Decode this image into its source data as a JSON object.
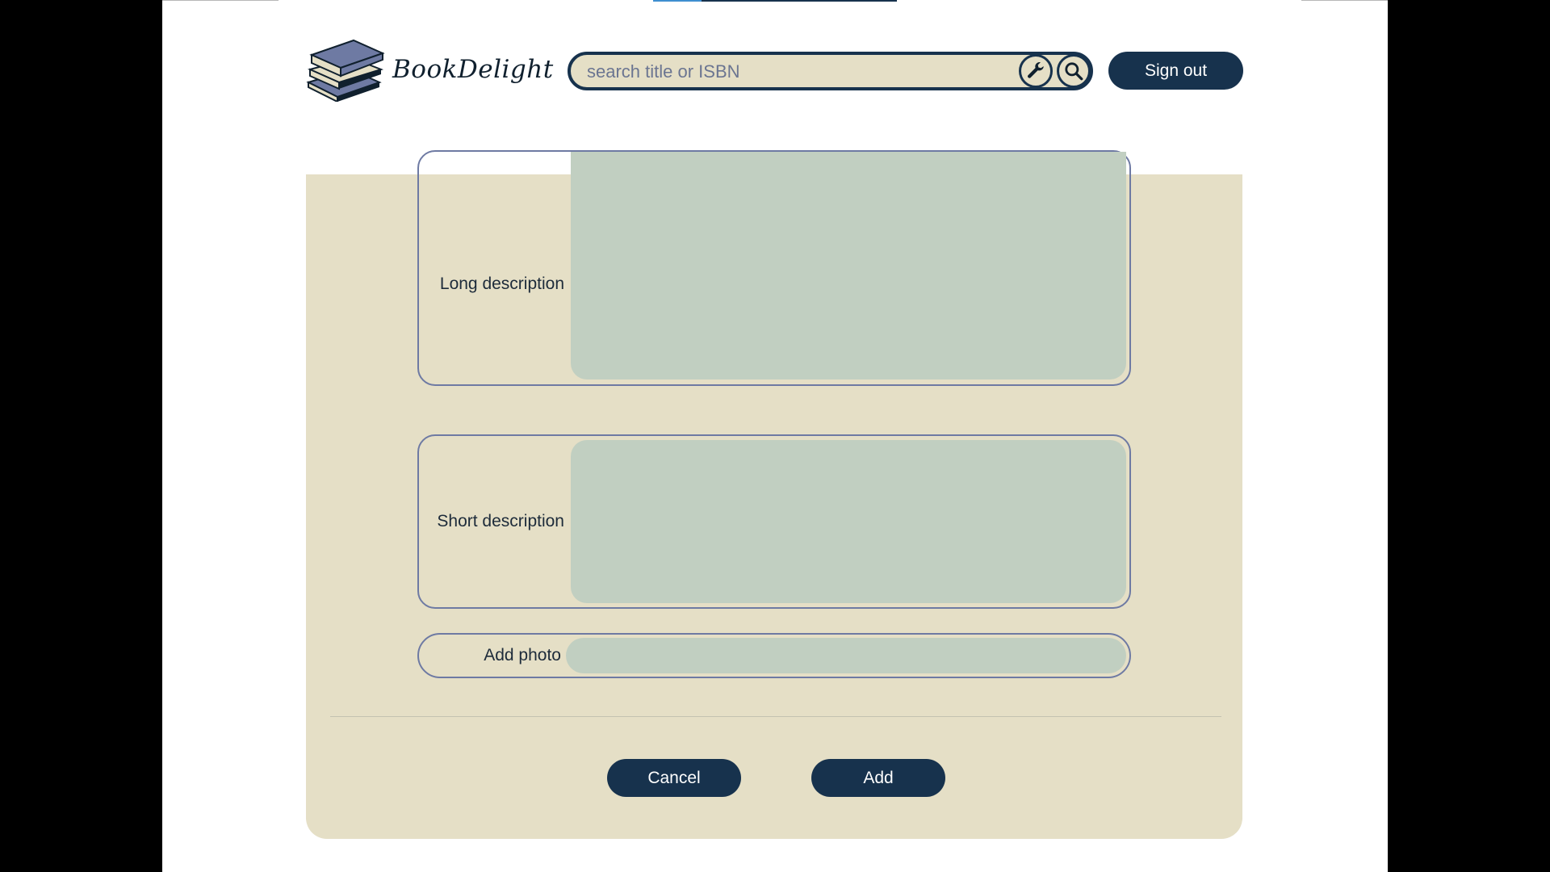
{
  "header": {
    "brand": "BookDelight",
    "search": {
      "placeholder": "search title or ISBN",
      "value": ""
    },
    "advanced_search_icon": "wrench-icon",
    "search_icon": "search-icon",
    "sign_out_label": "Sign out"
  },
  "form": {
    "long_description_label": "Long description",
    "short_description_label": "Short description",
    "add_photo_label": "Add photo",
    "cancel_label": "Cancel",
    "add_label": "Add"
  },
  "colors": {
    "primary": "#17324d",
    "panel_background": "#e5dfc6",
    "input_background": "#c1cfc1",
    "field_border": "#6e7aa3"
  }
}
